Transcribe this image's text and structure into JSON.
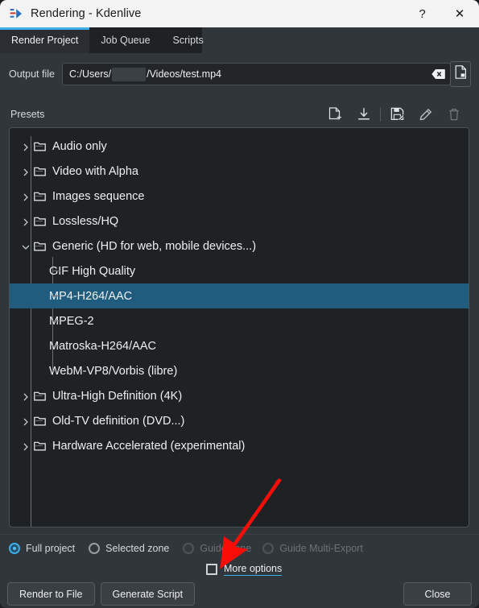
{
  "window": {
    "title": "Rendering - Kdenlive",
    "icon": "kdenlive-icon",
    "help_label": "?",
    "close_label": "✕"
  },
  "tabs": [
    {
      "label": "Render Project",
      "active": true
    },
    {
      "label": "Job Queue",
      "active": false
    },
    {
      "label": "Scripts",
      "active": false
    }
  ],
  "output": {
    "label": "Output file",
    "path_prefix": "C:/Users/",
    "path_suffix": "/Videos/test.mp4",
    "full_value": "C:/Users/<user>/Videos/test.mp4",
    "clear_icon": "clear-text-icon",
    "browse_icon": "file-browse-icon"
  },
  "presets": {
    "label": "Presets",
    "tools": [
      {
        "name": "new-preset-icon",
        "enabled": true
      },
      {
        "name": "import-preset-icon",
        "enabled": true
      },
      {
        "name": "save-preset-icon",
        "enabled": true
      },
      {
        "name": "edit-preset-icon",
        "enabled": true
      },
      {
        "name": "delete-preset-icon",
        "enabled": false
      }
    ],
    "tree": [
      {
        "label": "Audio only",
        "type": "folder",
        "expanded": false,
        "selected": false
      },
      {
        "label": "Video with Alpha",
        "type": "folder",
        "expanded": false,
        "selected": false
      },
      {
        "label": "Images sequence",
        "type": "folder",
        "expanded": false,
        "selected": false
      },
      {
        "label": "Lossless/HQ",
        "type": "folder",
        "expanded": false,
        "selected": false
      },
      {
        "label": "Generic (HD for web, mobile devices...)",
        "type": "folder",
        "expanded": true,
        "selected": false
      },
      {
        "label": "GIF High Quality",
        "type": "item",
        "selected": false
      },
      {
        "label": "MP4-H264/AAC",
        "type": "item",
        "selected": true
      },
      {
        "label": "MPEG-2",
        "type": "item",
        "selected": false
      },
      {
        "label": "Matroska-H264/AAC",
        "type": "item",
        "selected": false
      },
      {
        "label": "WebM-VP8/Vorbis (libre)",
        "type": "item",
        "selected": false
      },
      {
        "label": "Ultra-High Definition (4K)",
        "type": "folder",
        "expanded": false,
        "selected": false
      },
      {
        "label": "Old-TV definition (DVD...)",
        "type": "folder",
        "expanded": false,
        "selected": false
      },
      {
        "label": "Hardware Accelerated (experimental)",
        "type": "folder",
        "expanded": false,
        "selected": false
      }
    ],
    "selected_preset": "MP4-H264/AAC"
  },
  "scope": {
    "options": [
      {
        "label": "Full project",
        "checked": true,
        "enabled": true
      },
      {
        "label": "Selected zone",
        "checked": false,
        "enabled": true
      },
      {
        "label": "Guide zone",
        "checked": false,
        "enabled": false
      },
      {
        "label": "Guide Multi-Export",
        "checked": false,
        "enabled": false
      }
    ]
  },
  "more_options": {
    "label": "More options",
    "checked": false
  },
  "buttons": {
    "render_to_file": "Render to File",
    "generate_script": "Generate Script",
    "close": "Close"
  },
  "annotation": {
    "type": "arrow",
    "color": "#fb0d07",
    "points_to": "More options"
  },
  "colors": {
    "accent": "#3daee9",
    "selection": "#1f5c7d",
    "window_bg": "#31363b",
    "tree_bg": "#1e2225",
    "titlebar_bg": "#f3f3f3",
    "annotation_red": "#fb0d07"
  }
}
